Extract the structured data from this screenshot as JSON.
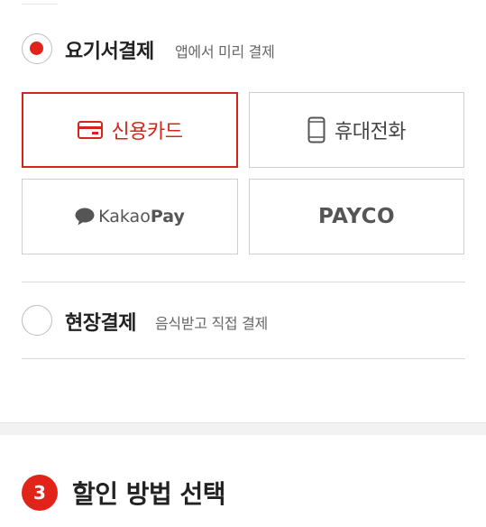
{
  "online_payment": {
    "title": "요기서결제",
    "subtitle": "앱에서 미리 결제",
    "selected": true,
    "methods": [
      {
        "label": "신용카드",
        "icon": "credit-card-icon",
        "selected": true
      },
      {
        "label": "휴대전화",
        "icon": "mobile-phone-icon",
        "selected": false
      },
      {
        "label_prefix": "Kakao",
        "label_suffix": "Pay",
        "icon": "kakao-chat-icon",
        "selected": false
      },
      {
        "label": "PAYCO",
        "selected": false
      }
    ]
  },
  "onsite_payment": {
    "title": "현장결제",
    "subtitle": "음식받고 직접 결제",
    "selected": false
  },
  "discount_section": {
    "step": "3",
    "title": "할인 방법 선택"
  },
  "colors": {
    "accent": "#e2231a",
    "border": "#cfcfcf",
    "text": "#222222"
  }
}
